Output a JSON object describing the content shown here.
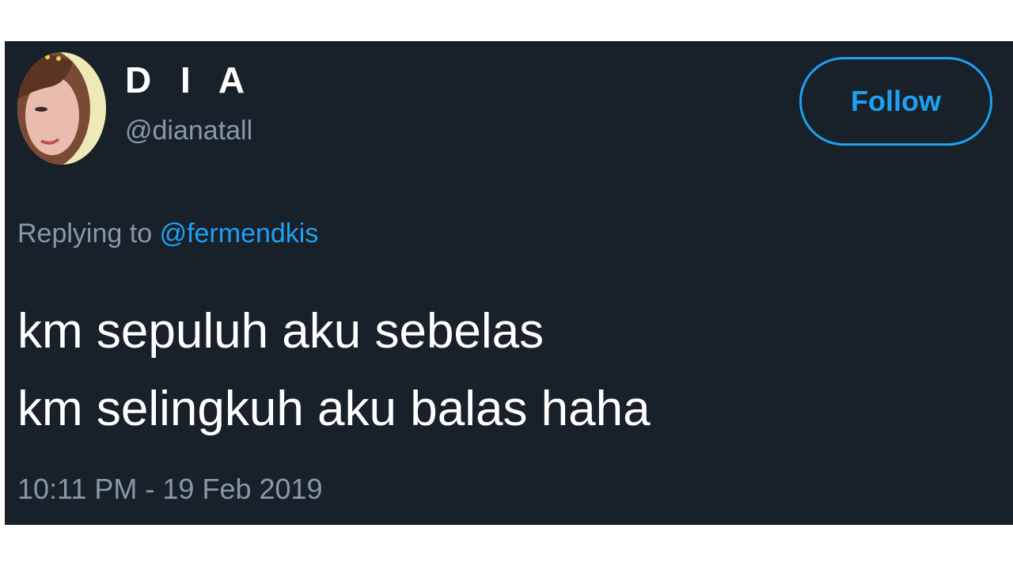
{
  "tweet": {
    "author": {
      "display_name": "D I A",
      "handle": "@dianatall",
      "avatar_icon": "profile-photo"
    },
    "follow_button": {
      "label": "Follow",
      "color": "#1da1f2"
    },
    "replying": {
      "prefix": "Replying to",
      "mention": "@fermendkis"
    },
    "text_lines": [
      "km sepuluh aku sebelas",
      "km selingkuh aku balas haha"
    ],
    "timestamp": "10:11 PM - 19 Feb 2019"
  },
  "colors": {
    "background": "#18202a",
    "accent": "#1da1f2",
    "muted_text": "#8899a6",
    "primary_text": "#ffffff"
  }
}
